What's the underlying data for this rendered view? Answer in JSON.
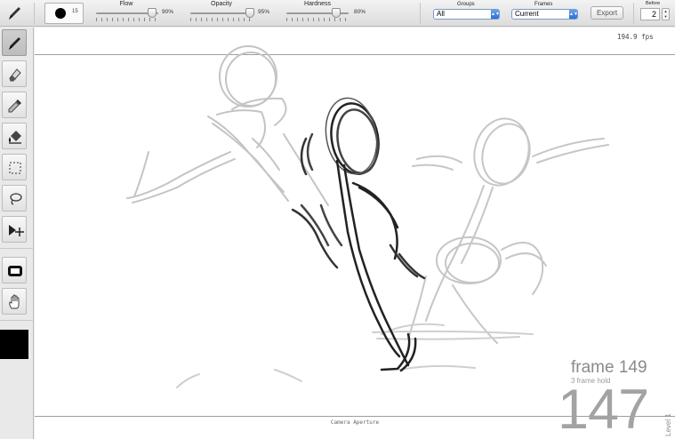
{
  "toolbar": {
    "brush_size": "15",
    "flow": {
      "label": "Flow",
      "value_text": "90%",
      "value": 90
    },
    "opacity": {
      "label": "Opacity",
      "value_text": "95%",
      "value": 95
    },
    "hardness": {
      "label": "Hardness",
      "value_text": "80%",
      "value": 80
    },
    "groups": {
      "label": "Groups",
      "selected": "All"
    },
    "frames": {
      "label": "Frames",
      "selected": "Current"
    },
    "export_label": "Export",
    "before": {
      "label": "Before",
      "value": "2"
    }
  },
  "tools": [
    {
      "name": "brush-tool",
      "icon": "pencil-icon",
      "active": true
    },
    {
      "name": "eraser-tool",
      "icon": "eraser-icon",
      "active": false
    },
    {
      "name": "eyedropper-tool",
      "icon": "eyedropper-icon",
      "active": false
    },
    {
      "name": "fill-tool",
      "icon": "paint-bucket-icon",
      "active": false
    },
    {
      "name": "rect-select-tool",
      "icon": "marquee-select-icon",
      "active": false
    },
    {
      "name": "lasso-tool",
      "icon": "lasso-icon",
      "active": false
    },
    {
      "name": "move-tool",
      "icon": "move-arrow-icon",
      "active": false
    },
    {
      "name": "camera-tool",
      "icon": "camera-frame-icon",
      "active": false
    },
    {
      "name": "hand-tool",
      "icon": "hand-icon",
      "active": false
    }
  ],
  "colors": {
    "current": "#000000",
    "accent": "#2c6fd1"
  },
  "canvas": {
    "fps": "194.9 fps",
    "camera_aperture": "Camera Aperture",
    "frame_label": "frame 149",
    "frame_hold": "3 frame hold",
    "frame_number": "147",
    "level": "Level 1"
  }
}
